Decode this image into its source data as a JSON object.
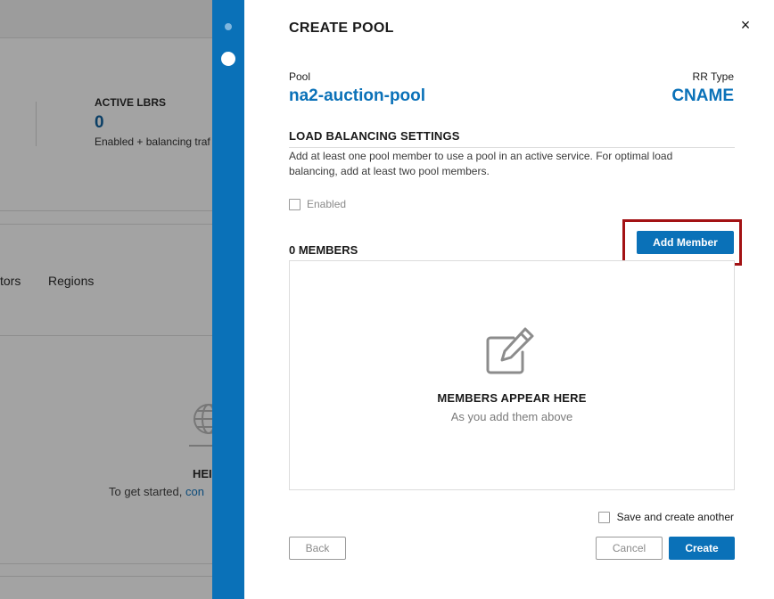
{
  "background": {
    "active_lbrs": {
      "title": "ACTIVE LBRS",
      "count": "0",
      "subtitle": "Enabled + balancing traf"
    },
    "tabs": [
      "tors",
      "Regions"
    ],
    "empty_state": {
      "title": "HEI",
      "subtitle_prefix": "To get started, ",
      "subtitle_link": "con"
    }
  },
  "panel": {
    "title": "CREATE POOL",
    "close_icon": "×",
    "pool": {
      "label": "Pool",
      "name": "na2-auction-pool"
    },
    "rr_type": {
      "label": "RR Type",
      "value": "CNAME"
    },
    "load_balancing": {
      "heading": "LOAD BALANCING SETTINGS",
      "description": "Add at least one pool member to use a pool in an active service. For optimal load balancing, add at least two pool members.",
      "enabled_label": "Enabled"
    },
    "members": {
      "heading": "0 MEMBERS",
      "add_button": "Add Member",
      "empty_title": "MEMBERS APPEAR HERE",
      "empty_subtitle": "As you add them above",
      "empty_icon": "edit-icon"
    },
    "footer": {
      "save_another_label": "Save and create another",
      "back_button": "Back",
      "cancel_button": "Cancel",
      "create_button": "Create"
    }
  },
  "colors": {
    "accent": "#0a71b8",
    "highlight": "#a31214",
    "overlay": "#a3a3a3"
  }
}
